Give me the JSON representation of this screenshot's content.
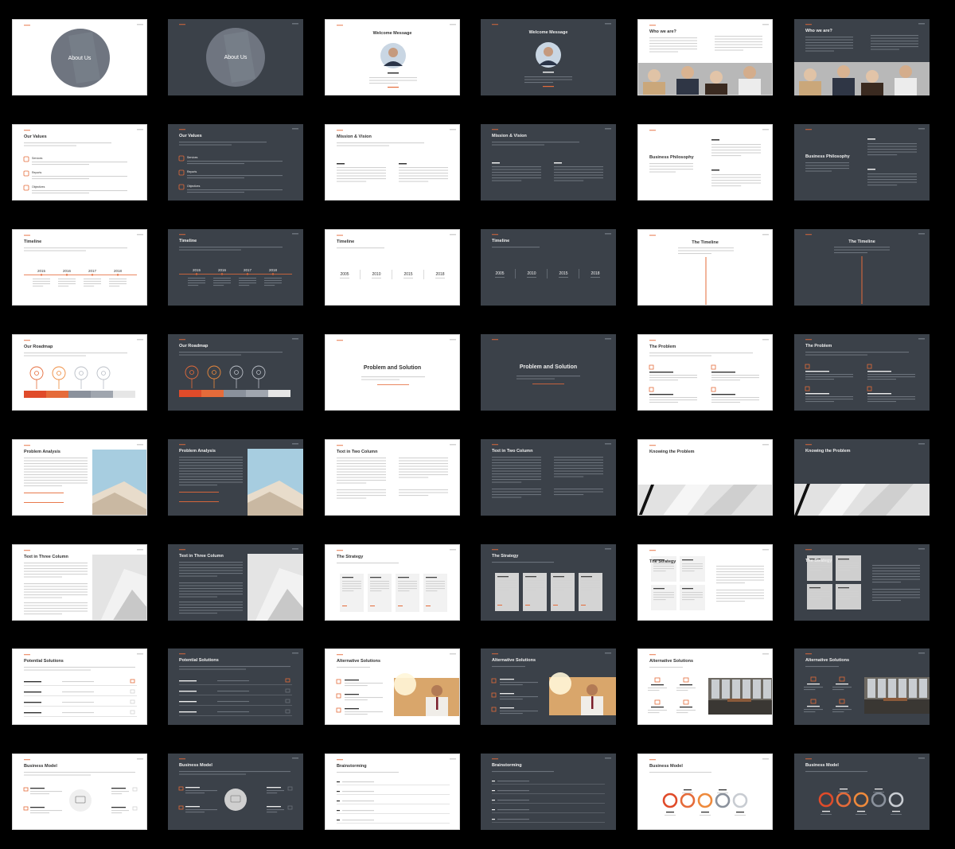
{
  "colors": {
    "accent": "#e56b3a",
    "dark_bg": "#3b4149",
    "light_bg": "#ffffff",
    "canvas": "#000000"
  },
  "slides": [
    {
      "id": "about-light",
      "theme": "light",
      "kind": "circle",
      "title": "About Us"
    },
    {
      "id": "about-dark",
      "theme": "dark",
      "kind": "circle",
      "title": "About Us"
    },
    {
      "id": "welcome-light",
      "theme": "light",
      "kind": "portrait",
      "title": "Welcome Message"
    },
    {
      "id": "welcome-dark",
      "theme": "dark",
      "kind": "portrait",
      "title": "Welcome Message"
    },
    {
      "id": "who-light",
      "theme": "light",
      "kind": "people",
      "title": "Who we are?"
    },
    {
      "id": "who-dark",
      "theme": "dark",
      "kind": "people",
      "title": "Who we are?"
    },
    {
      "id": "values-light",
      "theme": "light",
      "kind": "values",
      "title": "Our Values",
      "items": [
        "Services",
        "Reports",
        "Objectives"
      ]
    },
    {
      "id": "values-dark",
      "theme": "dark",
      "kind": "values",
      "title": "Our Values",
      "items": [
        "Services",
        "Reports",
        "Objectives"
      ]
    },
    {
      "id": "mission-light",
      "theme": "light",
      "kind": "twocol",
      "title": "Mission & Vision"
    },
    {
      "id": "mission-dark",
      "theme": "dark",
      "kind": "twocol",
      "title": "Mission & Vision"
    },
    {
      "id": "philosophy-light",
      "theme": "light",
      "kind": "philosophy",
      "title": "Business Philosophy"
    },
    {
      "id": "philosophy-dark",
      "theme": "dark",
      "kind": "philosophy",
      "title": "Business Philosophy"
    },
    {
      "id": "timeline1-light",
      "theme": "light",
      "kind": "timeline",
      "title": "Timeline",
      "years": [
        "2015",
        "2016",
        "2017",
        "2018"
      ]
    },
    {
      "id": "timeline1-dark",
      "theme": "dark",
      "kind": "timeline",
      "title": "Timeline",
      "years": [
        "2015",
        "2016",
        "2017",
        "2018"
      ]
    },
    {
      "id": "timeline2-light",
      "theme": "light",
      "kind": "timeline2",
      "title": "Timeline",
      "years": [
        "2005",
        "2010",
        "2015",
        "2018"
      ]
    },
    {
      "id": "timeline2-dark",
      "theme": "dark",
      "kind": "timeline2",
      "title": "Timeline",
      "years": [
        "2005",
        "2010",
        "2015",
        "2018"
      ]
    },
    {
      "id": "timeline3-light",
      "theme": "light",
      "kind": "vtimeline",
      "title": "The Timeline"
    },
    {
      "id": "timeline3-dark",
      "theme": "dark",
      "kind": "vtimeline",
      "title": "The Timeline"
    },
    {
      "id": "roadmap-light",
      "theme": "light",
      "kind": "roadmap",
      "title": "Our Roadmap"
    },
    {
      "id": "roadmap-dark",
      "theme": "dark",
      "kind": "roadmap",
      "title": "Our Roadmap"
    },
    {
      "id": "ps-light",
      "theme": "light",
      "kind": "section",
      "title": "Problem and Solution"
    },
    {
      "id": "ps-dark",
      "theme": "dark",
      "kind": "section",
      "title": "Problem and Solution"
    },
    {
      "id": "problem-light",
      "theme": "light",
      "kind": "problem",
      "title": "The Problem"
    },
    {
      "id": "problem-dark",
      "theme": "dark",
      "kind": "problem",
      "title": "The Problem"
    },
    {
      "id": "analysis-light",
      "theme": "light",
      "kind": "analysis",
      "title": "Problem Analysis"
    },
    {
      "id": "analysis-dark",
      "theme": "dark",
      "kind": "analysis",
      "title": "Problem Analysis"
    },
    {
      "id": "text2-light",
      "theme": "light",
      "kind": "text2",
      "title": "Text in Two Column"
    },
    {
      "id": "text2-dark",
      "theme": "dark",
      "kind": "text2",
      "title": "Text in Two Column"
    },
    {
      "id": "knowing-light",
      "theme": "light",
      "kind": "knowing",
      "title": "Knowing the Problem"
    },
    {
      "id": "knowing-dark",
      "theme": "dark",
      "kind": "knowing",
      "title": "Knowing the Problem"
    },
    {
      "id": "text3-light",
      "theme": "light",
      "kind": "text3",
      "title": "Text in Three Column"
    },
    {
      "id": "text3-dark",
      "theme": "dark",
      "kind": "text3",
      "title": "Text in Three Column"
    },
    {
      "id": "strategy1-light",
      "theme": "light",
      "kind": "strategy4",
      "title": "The Strategy"
    },
    {
      "id": "strategy1-dark",
      "theme": "dark",
      "kind": "strategy4",
      "title": "The Strategy"
    },
    {
      "id": "strategy2-light",
      "theme": "light",
      "kind": "strategygrid",
      "title": "The Strategy"
    },
    {
      "id": "strategy2-dark",
      "theme": "dark",
      "kind": "strategygrid",
      "title": "The Strategy"
    },
    {
      "id": "solutions-light",
      "theme": "light",
      "kind": "solutions",
      "title": "Potential Solutions"
    },
    {
      "id": "solutions-dark",
      "theme": "dark",
      "kind": "solutions",
      "title": "Potential Solutions"
    },
    {
      "id": "alt1-light",
      "theme": "light",
      "kind": "alt1",
      "title": "Alternative Solutions"
    },
    {
      "id": "alt1-dark",
      "theme": "dark",
      "kind": "alt1",
      "title": "Alternative Solutions"
    },
    {
      "id": "alt2-light",
      "theme": "light",
      "kind": "alt2",
      "title": "Alternative Solutions"
    },
    {
      "id": "alt2-dark",
      "theme": "dark",
      "kind": "alt2",
      "title": "Alternative Solutions"
    },
    {
      "id": "model1-light",
      "theme": "light",
      "kind": "model1",
      "title": "Business Model"
    },
    {
      "id": "model1-dark",
      "theme": "dark",
      "kind": "model1",
      "title": "Business Model"
    },
    {
      "id": "brainstorm-light",
      "theme": "light",
      "kind": "brainstorm",
      "title": "Brainstorming"
    },
    {
      "id": "brainstorm-dark",
      "theme": "dark",
      "kind": "brainstorm",
      "title": "Brainstorming"
    },
    {
      "id": "model2-light",
      "theme": "light",
      "kind": "model2",
      "title": "Business Model"
    },
    {
      "id": "model2-dark",
      "theme": "dark",
      "kind": "model2",
      "title": "Business Model"
    }
  ]
}
